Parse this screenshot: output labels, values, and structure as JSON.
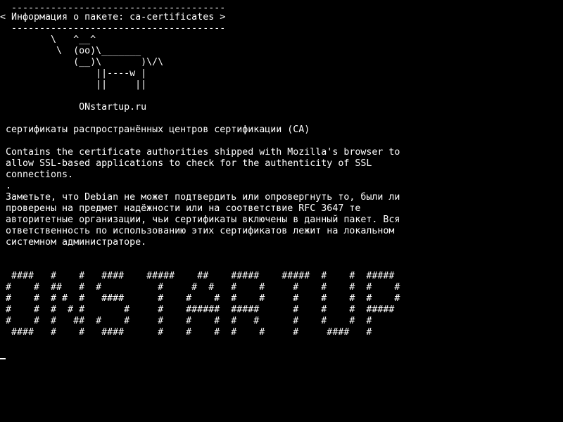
{
  "speech_bubble": {
    "top_border": " --------------------------------------",
    "text": "< Информация о пакете: ca-certificates >",
    "bottom_border": " --------------------------------------"
  },
  "cow_art": [
    "        \\   ^__^",
    "         \\  (oo)\\_______",
    "            (__)\\       )\\/\\",
    "                ||----w |",
    "                ||     ||"
  ],
  "site_label": "             ONstartup.ru",
  "package_summary": "сертификаты распространённых центров сертификации (CA)",
  "description_lines": [
    "Contains the certificate authorities shipped with Mozilla's browser to",
    "allow SSL-based applications to check for the authenticity of SSL",
    "connections.",
    "."
  ],
  "notice_lines": [
    "Заметьте, что Debian не может подтвердить или опровергнуть то, были ли",
    "проверены на предмет надёжности или на соответствие RFC 3647 те",
    "авторитетные организации, чьи сертификаты включены в данный пакет. Вся",
    "ответственность по использованию этих сертификатов лежит на локальном",
    "системном администраторе."
  ],
  "banner_art": [
    " ####   #    #   ####    #####    ##    #####    #####  #    #  #####",
    "#    #  ##   #  #          #     #  #   #    #     #    #    #  #    #",
    "#    #  # #  #   ####      #    #    #  #    #     #    #    #  #    #",
    "#    #  #  # #       #     #    ######  #####      #    #    #  #####",
    "#    #  #   ##  #    #     #    #    #  #   #      #    #    #  #",
    " ####   #    #   ####      #    #    #  #    #     #     ####   #"
  ],
  "colors": {
    "background": "#000000",
    "foreground": "#ffffff"
  }
}
